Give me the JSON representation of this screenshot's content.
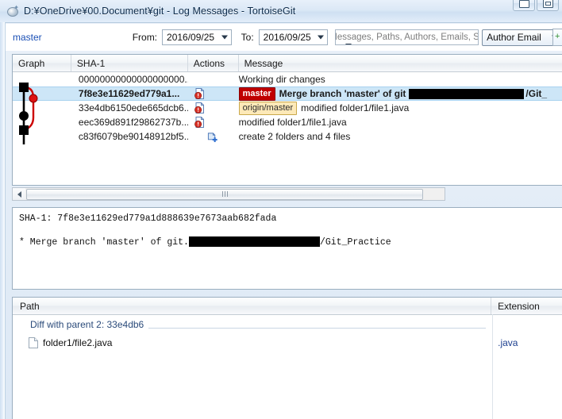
{
  "window": {
    "title": "D:¥OneDrive¥00.Document¥git - Log Messages - TortoiseGit",
    "icon": "tortoisegit-icon",
    "minimize_label": "Minimize",
    "restore_label": "Restore"
  },
  "toolbar": {
    "branch": "master",
    "from_label": "From:",
    "from_value": "2016/09/25",
    "to_label": "To:",
    "to_value": "2016/09/25",
    "search_placeholder": "Messages, Paths, Authors, Emails, SHA",
    "search_value": "",
    "filter_mode": "Author Email",
    "add_button_label": "+"
  },
  "log": {
    "columns": [
      "Graph",
      "SHA-1",
      "Actions",
      "Message"
    ],
    "rows": [
      {
        "sha": "00000000000000000000...",
        "message": "Working dir changes",
        "action_icon": "",
        "refs": [],
        "selected": false,
        "redacted": false
      },
      {
        "sha": "7f8e3e11629ed779a1...",
        "message": "Merge branch 'master' of git",
        "message_tail": "/Git_",
        "action_icon": "modified-icon",
        "refs": [
          {
            "name": "master",
            "style": "head"
          }
        ],
        "selected": true,
        "redacted": true
      },
      {
        "sha": "33e4db6150ede665dcb6...",
        "message": "modified folder1/file1.java",
        "action_icon": "modified-icon",
        "refs": [
          {
            "name": "origin/master",
            "style": "remote"
          }
        ],
        "selected": false,
        "redacted": false
      },
      {
        "sha": "eec369d891f29862737b...",
        "message": "modified folder1/file1.java",
        "action_icon": "modified-icon",
        "refs": [],
        "selected": false,
        "redacted": false
      },
      {
        "sha": "c83f6079be90148912bf5...",
        "message": "create 2 folders and 4 files",
        "action_icon": "added-icon",
        "refs": [],
        "selected": false,
        "redacted": false
      }
    ]
  },
  "detail": {
    "sha_line": "SHA-1: 7f8e3e11629ed779a1d888639e7673aab682fada",
    "message_prefix": "* Merge branch 'master' of git.",
    "message_suffix": "/Git_Practice"
  },
  "files": {
    "columns": [
      "Path",
      "Extension"
    ],
    "group_label": "Diff with parent 2: 33e4db6",
    "rows": [
      {
        "path": "folder1/file2.java",
        "extension": ".java",
        "icon": "file-icon"
      }
    ]
  },
  "colors": {
    "ref_head_bg": "#c00000",
    "ref_remote_bg": "#fde9b8",
    "selection": "#cde6f7",
    "link": "#1a4fb5",
    "graph_main": "#000000",
    "graph_branch": "#cc0000"
  }
}
